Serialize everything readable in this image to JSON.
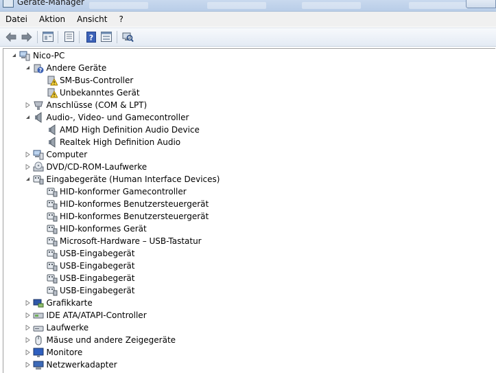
{
  "window": {
    "title": "Geräte-Manager"
  },
  "menu": [
    "Datei",
    "Aktion",
    "Ansicht",
    "?"
  ],
  "toolbar": [
    "back-icon",
    "forward-icon",
    "properties-icon",
    "list-icon",
    "help-icon",
    "view-icon",
    "scan-hardware-icon"
  ],
  "tree": [
    {
      "label": "Nico-PC",
      "level": 0,
      "expander": "expanded",
      "icon": "computer-icon"
    },
    {
      "label": "Andere Geräte",
      "level": 1,
      "expander": "expanded",
      "icon": "unknown-device-icon"
    },
    {
      "label": "SM-Bus-Controller",
      "level": 2,
      "expander": "none",
      "icon": "warning-device-icon"
    },
    {
      "label": "Unbekanntes Gerät",
      "level": 2,
      "expander": "none",
      "icon": "warning-device-icon"
    },
    {
      "label": "Anschlüsse (COM & LPT)",
      "level": 1,
      "expander": "collapsed",
      "icon": "port-icon"
    },
    {
      "label": "Audio-, Video- und Gamecontroller",
      "level": 1,
      "expander": "expanded",
      "icon": "speaker-icon"
    },
    {
      "label": "AMD High Definition Audio Device",
      "level": 2,
      "expander": "none",
      "icon": "speaker-icon"
    },
    {
      "label": "Realtek High Definition Audio",
      "level": 2,
      "expander": "none",
      "icon": "speaker-icon"
    },
    {
      "label": "Computer",
      "level": 1,
      "expander": "collapsed",
      "icon": "computer-icon"
    },
    {
      "label": "DVD/CD-ROM-Laufwerke",
      "level": 1,
      "expander": "collapsed",
      "icon": "dvd-drive-icon"
    },
    {
      "label": "Eingabegeräte (Human Interface Devices)",
      "level": 1,
      "expander": "expanded",
      "icon": "hid-icon"
    },
    {
      "label": "HID-konformer Gamecontroller",
      "level": 2,
      "expander": "none",
      "icon": "hid-icon"
    },
    {
      "label": "HID-konformes Benutzersteuergerät",
      "level": 2,
      "expander": "none",
      "icon": "hid-icon"
    },
    {
      "label": "HID-konformes Benutzersteuergerät",
      "level": 2,
      "expander": "none",
      "icon": "hid-icon"
    },
    {
      "label": "HID-konformes Gerät",
      "level": 2,
      "expander": "none",
      "icon": "hid-icon"
    },
    {
      "label": "Microsoft-Hardware – USB-Tastatur",
      "level": 2,
      "expander": "none",
      "icon": "hid-icon"
    },
    {
      "label": "USB-Eingabegerät",
      "level": 2,
      "expander": "none",
      "icon": "hid-icon"
    },
    {
      "label": "USB-Eingabegerät",
      "level": 2,
      "expander": "none",
      "icon": "hid-icon"
    },
    {
      "label": "USB-Eingabegerät",
      "level": 2,
      "expander": "none",
      "icon": "hid-icon"
    },
    {
      "label": "USB-Eingabegerät",
      "level": 2,
      "expander": "none",
      "icon": "hid-icon"
    },
    {
      "label": "Grafikkarte",
      "level": 1,
      "expander": "collapsed",
      "icon": "display-adapter-icon"
    },
    {
      "label": "IDE ATA/ATAPI-Controller",
      "level": 1,
      "expander": "collapsed",
      "icon": "ide-controller-icon"
    },
    {
      "label": "Laufwerke",
      "level": 1,
      "expander": "collapsed",
      "icon": "disk-drive-icon"
    },
    {
      "label": "Mäuse und andere Zeigegeräte",
      "level": 1,
      "expander": "collapsed",
      "icon": "mouse-icon"
    },
    {
      "label": "Monitore",
      "level": 1,
      "expander": "collapsed",
      "icon": "monitor-icon"
    },
    {
      "label": "Netzwerkadapter",
      "level": 1,
      "expander": "collapsed",
      "icon": "network-adapter-icon"
    }
  ]
}
